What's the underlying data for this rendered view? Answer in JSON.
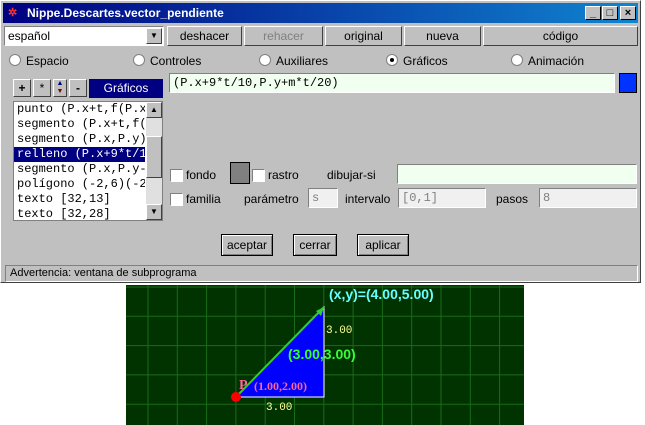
{
  "window": {
    "title": "Nippe.Descartes.vector_pendiente",
    "min_label": "_",
    "max_label": "□",
    "close_label": "×"
  },
  "toolbar": {
    "language": "español",
    "undo": "deshacer",
    "redo": "rehacer",
    "original": "original",
    "new": "nueva",
    "code": "código"
  },
  "tabs": [
    {
      "label": "Espacio",
      "selected": false
    },
    {
      "label": "Controles",
      "selected": false
    },
    {
      "label": "Auxiliares",
      "selected": false
    },
    {
      "label": "Gráficos",
      "selected": true
    },
    {
      "label": "Animación",
      "selected": false
    }
  ],
  "list_tools": {
    "add": "+",
    "dup": "*",
    "minus": "-",
    "header": "Gráficos"
  },
  "list_items": [
    {
      "text": "punto (P.x+t,f(P.x",
      "selected": false
    },
    {
      "text": "segmento (P.x+t,f(",
      "selected": false
    },
    {
      "text": "segmento (P.x,P.y)",
      "selected": false
    },
    {
      "text": "relleno (P.x+9*t/1",
      "selected": true
    },
    {
      "text": "segmento (P.x,P.y-",
      "selected": false
    },
    {
      "text": "polígono (-2,6)(-2",
      "selected": false
    },
    {
      "text": "texto [32,13]",
      "selected": false
    },
    {
      "text": "texto [32,28]",
      "selected": false
    }
  ],
  "expression": "(P.x+9*t/10,P.y+m*t/20)",
  "expression_color": "#0033ff",
  "form": {
    "fondo": "fondo",
    "rastro": "rastro",
    "rastro_color": "#808080",
    "dibujar_si": "dibujar-si",
    "dibujar_si_value": "",
    "familia": "familia",
    "parametro": "parámetro",
    "parametro_value": "s",
    "intervalo": "intervalo",
    "intervalo_value": "[0,1]",
    "pasos": "pasos",
    "pasos_value": "8"
  },
  "buttons": {
    "accept": "aceptar",
    "close": "cerrar",
    "apply": "aplicar"
  },
  "status": "Advertencia: ventana de subprograma",
  "canvas": {
    "coord_label": "(x,y)=(4.00,5.00)",
    "vector_label": "(3.00,3.00)",
    "point_name": "P",
    "point_label": "(1.00,2.00)",
    "dx_label": "3.00",
    "dy_label": "3.00",
    "colors": {
      "background": "#003300",
      "grid": "#1a6b1a",
      "fill": "#0000ff",
      "vector": "#33cc33",
      "point": "#ff0000",
      "label_white": "#66ffff",
      "label_green": "#33ff33",
      "label_point": "#ff6699",
      "label_dim": "#ffff99"
    }
  }
}
